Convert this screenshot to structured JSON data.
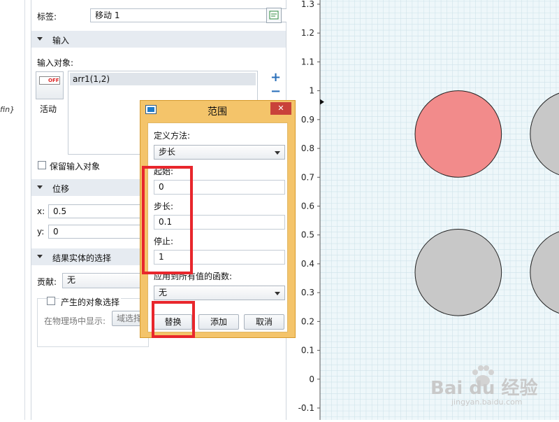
{
  "left_fragment": "fin}",
  "panel": {
    "label_caption": "标签:",
    "label_value": "移动 1",
    "sec_input": "输入",
    "input_objects_caption": "输入对象:",
    "toggle_text": "OFF",
    "toggle_label": "活动",
    "object_item": "arr1(1,2)",
    "add_symbol": "+",
    "remove_symbol": "−",
    "keep_input_label": "保留输入对象",
    "sec_displacement": "位移",
    "x_label": "x:",
    "x_value": "0.5",
    "y_label": "y:",
    "y_value": "0",
    "sec_result": "结果实体的选择",
    "contribute_label": "贡献:",
    "contribute_value": "无",
    "create_selection_label": "产生的对象选择",
    "show_in_physics_label": "在物理场中显示:",
    "domain_select_button": "域选择"
  },
  "dialog": {
    "title": "范围",
    "close_symbol": "✕",
    "define_method_label": "定义方法:",
    "define_method_value": "步长",
    "start_label": "起始:",
    "start_value": "0",
    "step_label": "步长:",
    "step_value": "0.1",
    "stop_label": "停止:",
    "stop_value": "1",
    "function_label": "应用到所有值的函数:",
    "function_value": "无",
    "replace_button": "替换",
    "add_button": "添加",
    "cancel_button": "取消",
    "highlight_color": "#e8262c"
  },
  "chart_data": {
    "type": "scatter",
    "y_ticks": [
      "1.3",
      "1.2",
      "1.1",
      "1",
      "0.9",
      "0.8",
      "0.7",
      "0.6",
      "0.5",
      "0.4",
      "0.3",
      "0.2",
      "0.1",
      "0",
      "-0.1"
    ],
    "y_tick_values": [
      1.3,
      1.2,
      1.1,
      1,
      0.9,
      0.8,
      0.7,
      0.6,
      0.5,
      0.4,
      0.3,
      0.2,
      0.1,
      0,
      -0.1
    ],
    "ylim": [
      -0.15,
      1.32
    ],
    "grid": true,
    "circles": [
      {
        "cx": 0.6,
        "cy": 0.85,
        "r": 0.15,
        "color": "#f28b8b"
      },
      {
        "cx": 1.0,
        "cy": 0.85,
        "r": 0.15,
        "color": "#c8c8c8"
      },
      {
        "cx": 0.6,
        "cy": 0.37,
        "r": 0.15,
        "color": "#c8c8c8"
      },
      {
        "cx": 1.0,
        "cy": 0.37,
        "r": 0.15,
        "color": "#c8c8c8"
      }
    ],
    "xlim": [
      0.12,
      1.08
    ]
  },
  "watermark": {
    "logo_text": "Bai du 经验",
    "url": "jingyan.baidu.com"
  }
}
